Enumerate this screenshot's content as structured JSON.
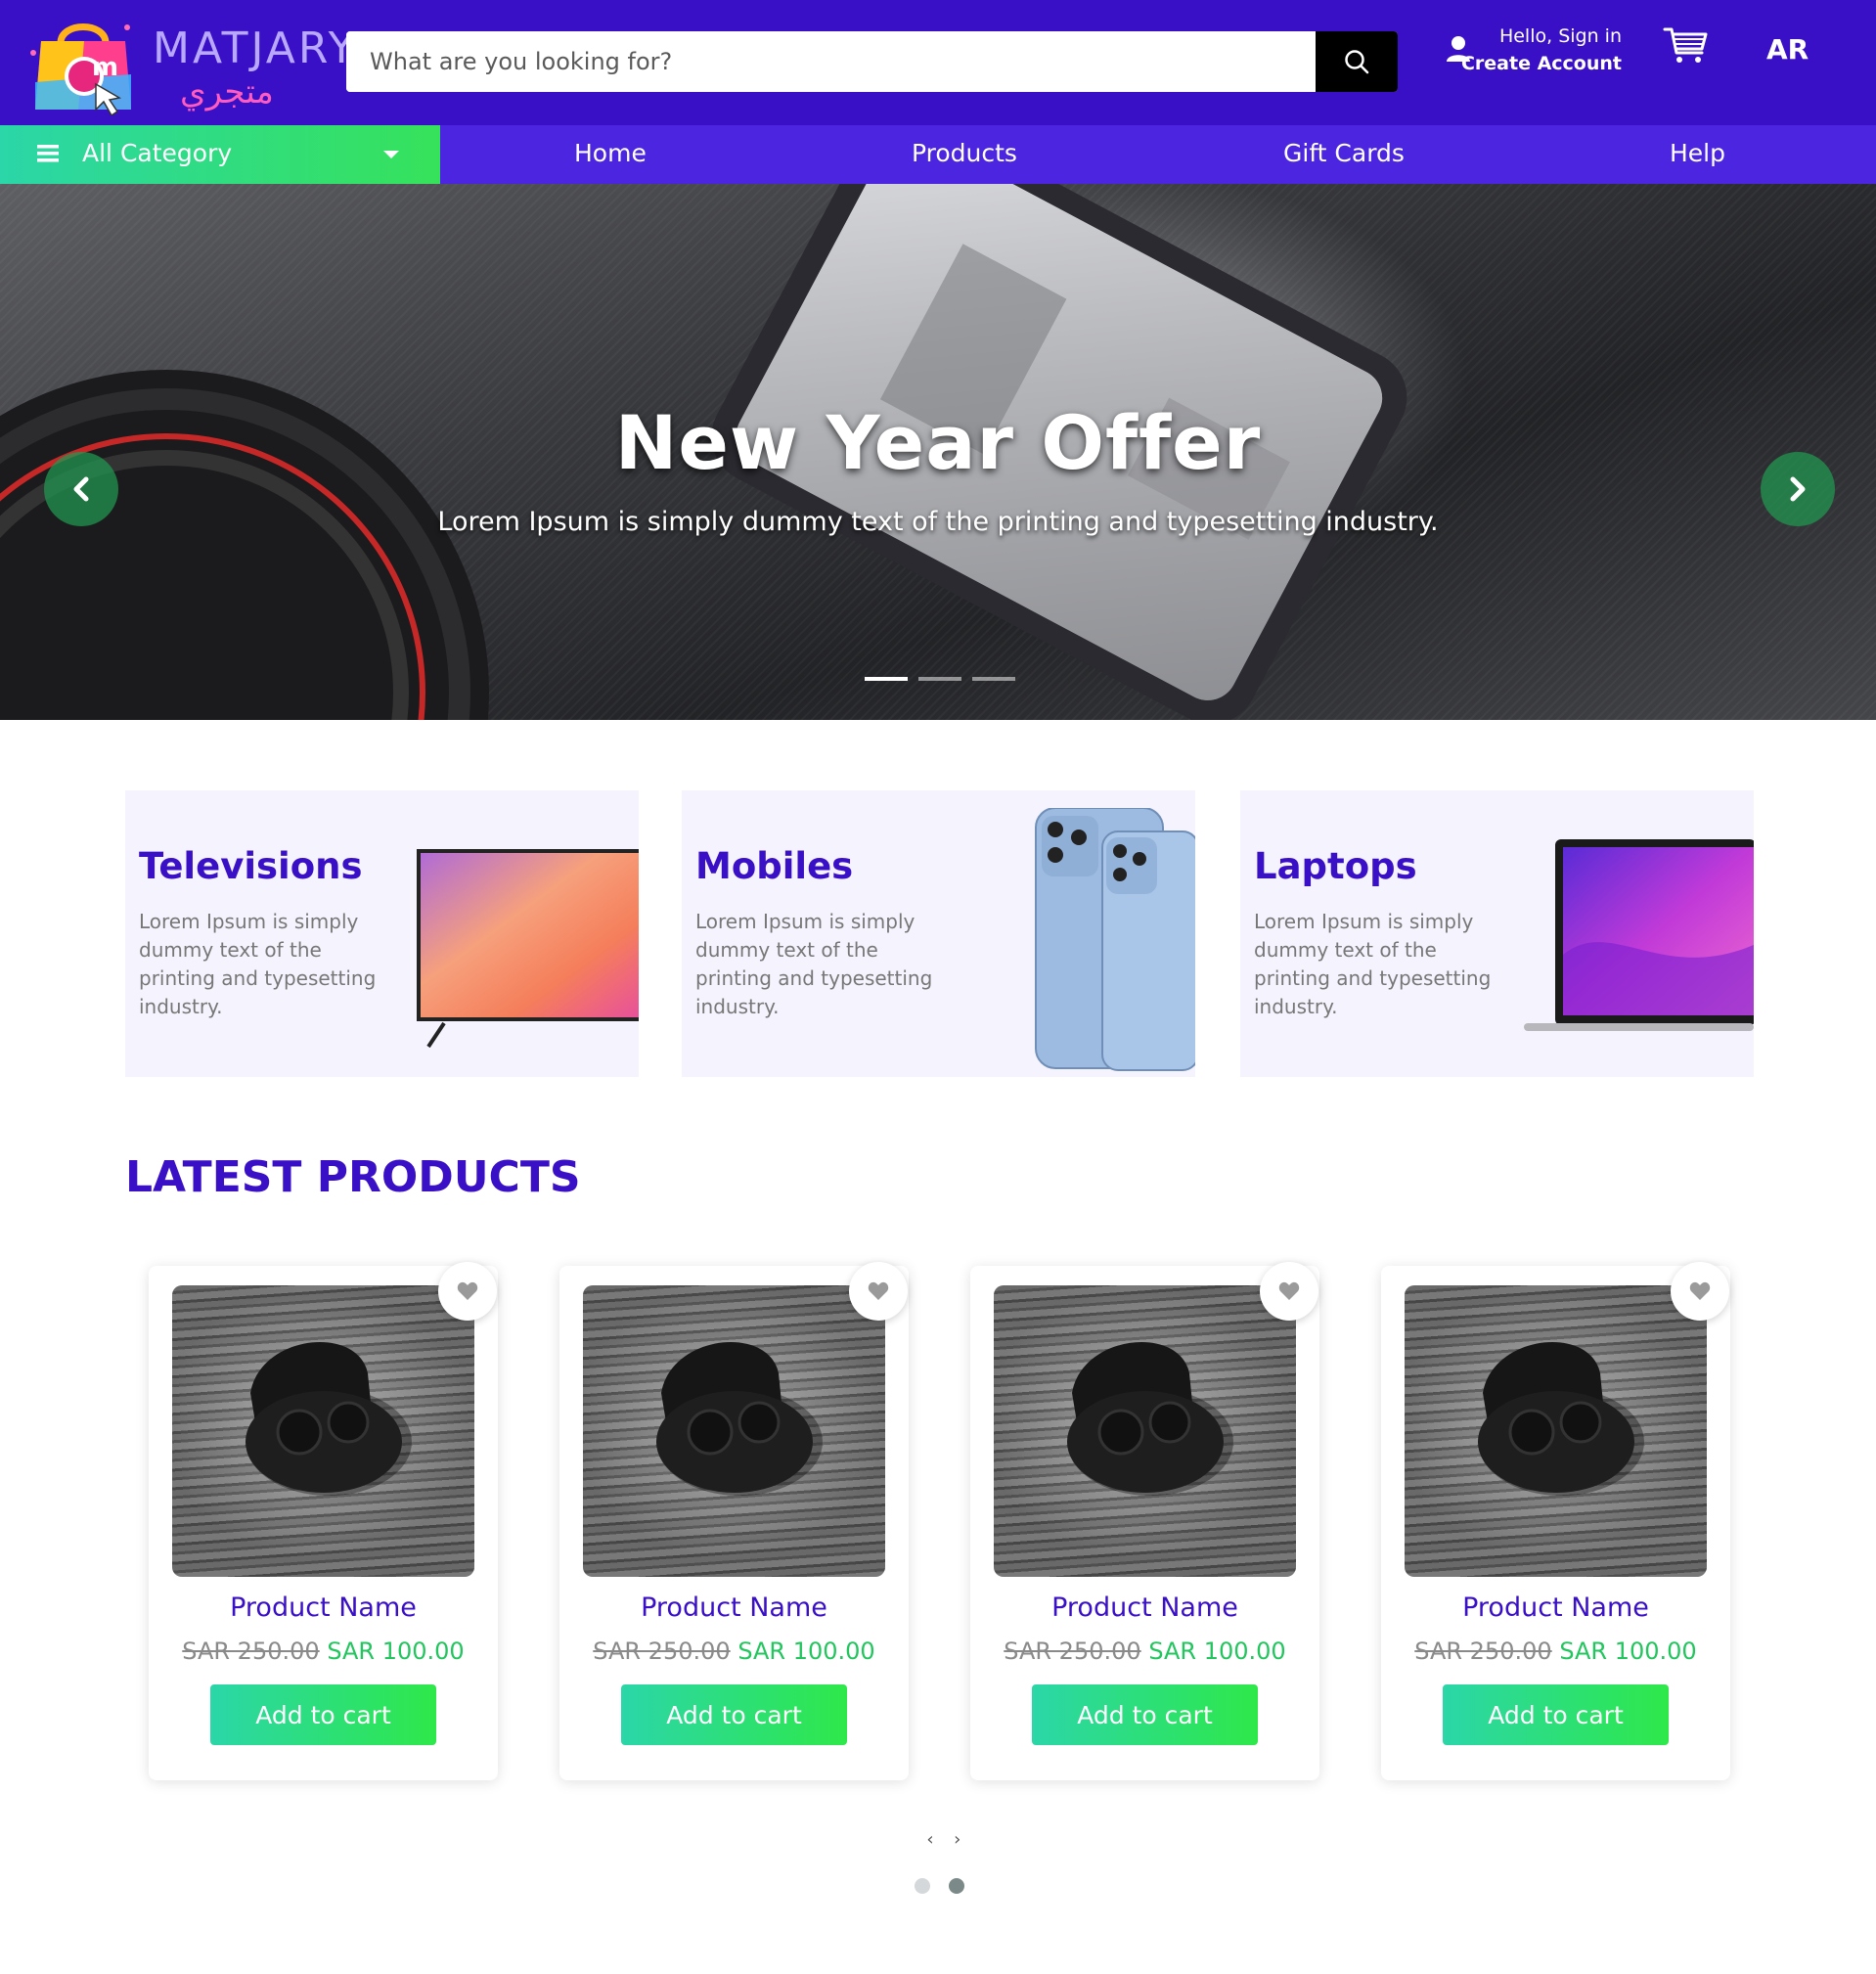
{
  "brand": {
    "name_en": "MATJARY",
    "name_ar": "متجري",
    "logo_letter": "m"
  },
  "search": {
    "placeholder": "What are you looking for?"
  },
  "account": {
    "greeting": "Hello, Sign in",
    "create": "Create Account"
  },
  "language": "AR",
  "nav": {
    "all_category": "All Category",
    "links": [
      "Home",
      "Products",
      "Gift Cards",
      "Help"
    ]
  },
  "hero": {
    "title": "New Year Offer",
    "subtitle": "Lorem Ipsum is simply dummy text of the printing and typesetting industry.",
    "slides_count": 3,
    "active_slide": 1
  },
  "categories": [
    {
      "title": "Televisions",
      "text": "Lorem Ipsum is simply dummy text of the printing and typesetting industry."
    },
    {
      "title": "Mobiles",
      "text": "Lorem Ipsum is simply dummy text of the printing and typesetting industry."
    },
    {
      "title": "Laptops",
      "text": "Lorem Ipsum is simply dummy text of the printing and typesetting industry."
    }
  ],
  "latest": {
    "title": "LATEST PRODUCTS",
    "products": [
      {
        "name": "Product Name",
        "old_price": "SAR 250.00",
        "new_price": "SAR 100.00",
        "button": "Add to cart"
      },
      {
        "name": "Product Name",
        "old_price": "SAR 250.00",
        "new_price": "SAR 100.00",
        "button": "Add to cart"
      },
      {
        "name": "Product Name",
        "old_price": "SAR 250.00",
        "new_price": "SAR 100.00",
        "button": "Add to cart"
      },
      {
        "name": "Product Name",
        "old_price": "SAR 250.00",
        "new_price": "SAR 100.00",
        "button": "Add to cart"
      }
    ],
    "pager": {
      "prev": "‹",
      "next": "›",
      "pages": 2,
      "active_page": 2
    }
  },
  "colors": {
    "header_bg": "#3a10c6",
    "nav_bg": "#4c25e0",
    "accent_green": "#22c55e",
    "heading_purple": "#3a10c6"
  }
}
